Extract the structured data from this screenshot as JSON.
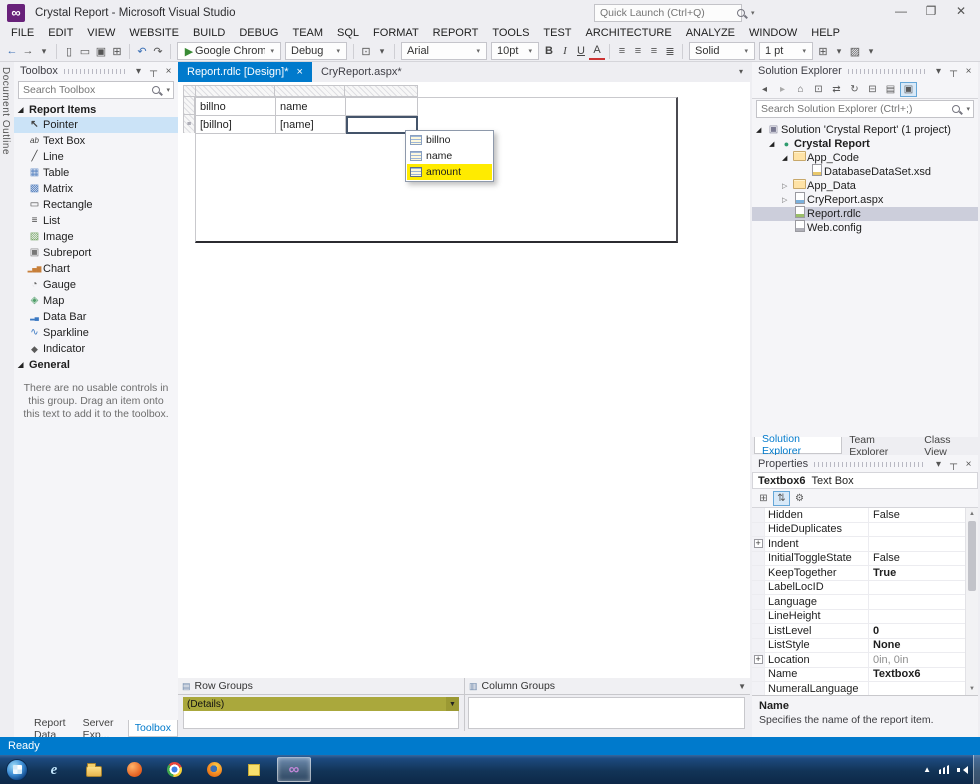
{
  "window": {
    "title": "Crystal Report - Microsoft Visual Studio",
    "quick_launch_placeholder": "Quick Launch (Ctrl+Q)"
  },
  "menu_items": [
    "FILE",
    "EDIT",
    "VIEW",
    "WEBSITE",
    "BUILD",
    "DEBUG",
    "TEAM",
    "SQL",
    "FORMAT",
    "REPORT",
    "TOOLS",
    "TEST",
    "ARCHITECTURE",
    "ANALYZE",
    "WINDOW",
    "HELP"
  ],
  "toolbar": {
    "run_target": "Google Chrome",
    "configuration": "Debug",
    "font_family": "Arial",
    "font_size": "10pt",
    "bold_label": "B",
    "italic_label": "I",
    "underline_label": "U",
    "color_label": "A",
    "border_style": "Solid",
    "border_width": "1 pt"
  },
  "left_edge_tab": "Document Outline",
  "toolbox": {
    "title": "Toolbox",
    "search_placeholder": "Search Toolbox",
    "group_report_items": "Report Items",
    "items": [
      {
        "label": "Pointer",
        "icon": "pointer-icon",
        "selected": true
      },
      {
        "label": "Text Box",
        "icon": "textbox-icon"
      },
      {
        "label": "Line",
        "icon": "line-icon"
      },
      {
        "label": "Table",
        "icon": "table-icon"
      },
      {
        "label": "Matrix",
        "icon": "matrix-icon"
      },
      {
        "label": "Rectangle",
        "icon": "rectangle-icon"
      },
      {
        "label": "List",
        "icon": "list-icon"
      },
      {
        "label": "Image",
        "icon": "image-icon"
      },
      {
        "label": "Subreport",
        "icon": "subreport-icon"
      },
      {
        "label": "Chart",
        "icon": "chart-icon"
      },
      {
        "label": "Gauge",
        "icon": "gauge-icon"
      },
      {
        "label": "Map",
        "icon": "map-icon"
      },
      {
        "label": "Data Bar",
        "icon": "databar-icon"
      },
      {
        "label": "Sparkline",
        "icon": "sparkline-icon"
      },
      {
        "label": "Indicator",
        "icon": "indicator-icon"
      }
    ],
    "group_general": "General",
    "general_empty_text": "There are no usable controls in this group. Drag an item onto this text to add it to the toolbox."
  },
  "bottom_left_tabs": [
    {
      "label": "Report Data"
    },
    {
      "label": "Server Exp..."
    },
    {
      "label": "Toolbox",
      "active": true
    }
  ],
  "editor": {
    "tabs": [
      {
        "label": "Report.rdlc [Design]*",
        "active": true
      },
      {
        "label": "CryReport.aspx*"
      }
    ],
    "table": {
      "header": [
        "billno",
        "name",
        ""
      ],
      "data": [
        "[billno]",
        "[name]",
        ""
      ]
    },
    "field_menu": {
      "items": [
        {
          "label": "billno"
        },
        {
          "label": "name"
        },
        {
          "label": "amount",
          "highlighted": true
        }
      ]
    },
    "groups": {
      "row_groups_label": "Row Groups",
      "column_groups_label": "Column Groups",
      "details_label": "(Details)"
    }
  },
  "solution_explorer": {
    "title": "Solution Explorer",
    "search_placeholder": "Search Solution Explorer (Ctrl+;)",
    "toolbar_icons": [
      {
        "icon": "circle-back-icon"
      },
      {
        "icon": "circle-forward-icon"
      },
      {
        "icon": "home-icon"
      },
      {
        "icon": "scope-icon"
      },
      {
        "icon": "sync-icon"
      },
      {
        "icon": "refresh-icon"
      },
      {
        "icon": "collapse-all-icon"
      },
      {
        "icon": "show-all-files-icon"
      },
      {
        "icon": "preview-icon",
        "active": true
      }
    ],
    "tree": [
      {
        "label": "Solution 'Crystal Report' (1 project)",
        "level": 0,
        "arrow": "expanded",
        "icon": "solution-icon"
      },
      {
        "label": "Crystal Report",
        "level": 1,
        "arrow": "expanded",
        "icon": "project-icon",
        "bold": true
      },
      {
        "label": "App_Code",
        "level": 2,
        "arrow": "expanded",
        "icon": "folder-icon"
      },
      {
        "label": "DatabaseDataSet.xsd",
        "level": 3,
        "arrow": "none",
        "icon": "dataset-icon"
      },
      {
        "label": "App_Data",
        "level": 2,
        "arrow": "collapsed",
        "icon": "folder-icon"
      },
      {
        "label": "CryReport.aspx",
        "level": 2,
        "arrow": "collapsed",
        "icon": "aspx-icon"
      },
      {
        "label": "Report.rdlc",
        "level": 2,
        "arrow": "none",
        "icon": "rdlc-icon",
        "selected": true
      },
      {
        "label": "Web.config",
        "level": 2,
        "arrow": "none",
        "icon": "config-icon"
      }
    ]
  },
  "right_panel_tabs": [
    {
      "label": "Solution Explorer",
      "active": true
    },
    {
      "label": "Team Explorer"
    },
    {
      "label": "Class View"
    }
  ],
  "properties": {
    "title": "Properties",
    "object_name": "Textbox6",
    "object_type": "Text Box",
    "toolbar_icons": [
      {
        "icon": "categorized-icon"
      },
      {
        "icon": "alphabetical-icon",
        "active": true
      },
      {
        "icon": "property-pages-icon"
      }
    ],
    "rows": [
      {
        "name": "Hidden",
        "value": "False"
      },
      {
        "name": "HideDuplicates",
        "value": ""
      },
      {
        "name": "Indent",
        "value": "",
        "expandable": true
      },
      {
        "name": "InitialToggleState",
        "value": "False"
      },
      {
        "name": "KeepTogether",
        "value": "True",
        "bold": true
      },
      {
        "name": "LabelLocID",
        "value": ""
      },
      {
        "name": "Language",
        "value": ""
      },
      {
        "name": "LineHeight",
        "value": ""
      },
      {
        "name": "ListLevel",
        "value": "0",
        "bold": true
      },
      {
        "name": "ListStyle",
        "value": "None",
        "bold": true
      },
      {
        "name": "Location",
        "value": "0in, 0in",
        "expandable": true,
        "muted": true
      },
      {
        "name": "Name",
        "value": "Textbox6",
        "bold": true
      },
      {
        "name": "NumeralLanguage",
        "value": ""
      }
    ],
    "description_title": "Name",
    "description_text": "Specifies the name of the report item."
  },
  "status_bar": {
    "text": "Ready"
  },
  "taskbar": {
    "apps": [
      {
        "icon": "ie-icon"
      },
      {
        "icon": "explorer-icon"
      },
      {
        "icon": "media-app-icon"
      },
      {
        "icon": "chrome-icon"
      },
      {
        "icon": "firefox-icon"
      },
      {
        "icon": "notes-icon"
      },
      {
        "icon": "visual-studio-icon",
        "active": true
      }
    ]
  },
  "colors": {
    "accent": "#007acc",
    "vs_purple": "#68217a",
    "field_highlight_yellow": "#ffeb00",
    "details_bar_olive": "#aaa83c"
  }
}
